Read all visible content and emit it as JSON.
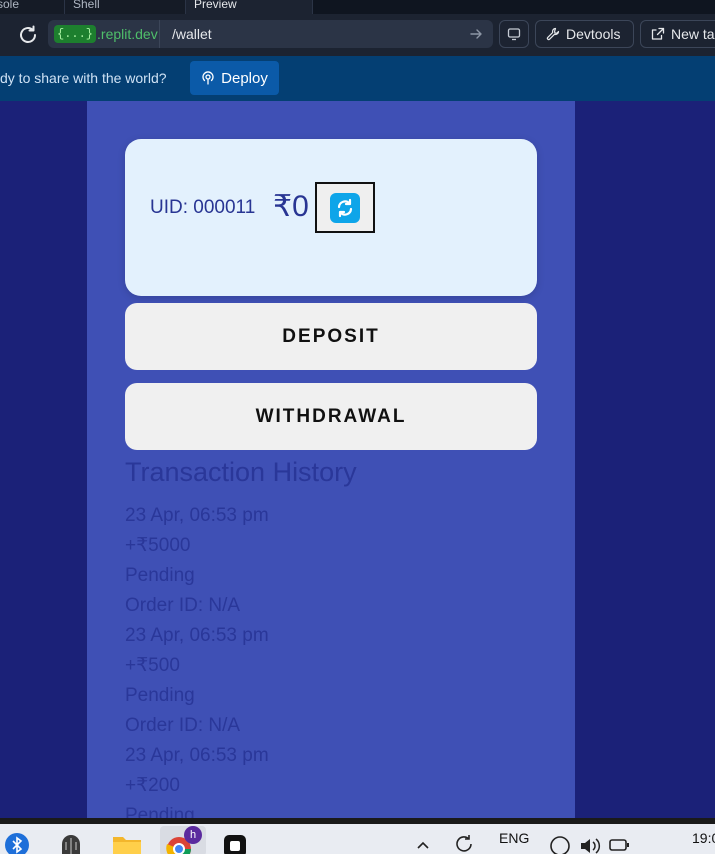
{
  "browser": {
    "tabs": [
      "sole",
      "Shell",
      "Preview"
    ],
    "url_badge": "{...}",
    "url_host": ".replit.dev",
    "url_path": "/wallet",
    "devtools_label": "Devtools",
    "new_tab_label": "New ta"
  },
  "banner": {
    "text": "dy to share with the world?",
    "deploy_label": "Deploy"
  },
  "wallet": {
    "uid": "UID: 000011",
    "balance": "₹0",
    "deposit_label": "DEPOSIT",
    "withdrawal_label": "WITHDRAWAL",
    "history_title": "Transaction History",
    "transactions": [
      {
        "date": "23 Apr, 06:53 pm",
        "amount": "+₹5000",
        "status": "Pending",
        "order": "Order ID: N/A"
      },
      {
        "date": "23 Apr, 06:53 pm",
        "amount": "+₹500",
        "status": "Pending",
        "order": "Order ID: N/A"
      },
      {
        "date": "23 Apr, 06:53 pm",
        "amount": "+₹200",
        "status": "Pending",
        "order": ""
      }
    ]
  },
  "taskbar": {
    "lang": "ENG",
    "clock": "19:0",
    "notification_badge": "h"
  },
  "colors": {
    "page_bg": "#1b2178",
    "panel_bg": "#3f50b5",
    "card_bg": "#e3f1fd",
    "accent": "#0ea5e9",
    "banner_bg": "#043f73"
  }
}
